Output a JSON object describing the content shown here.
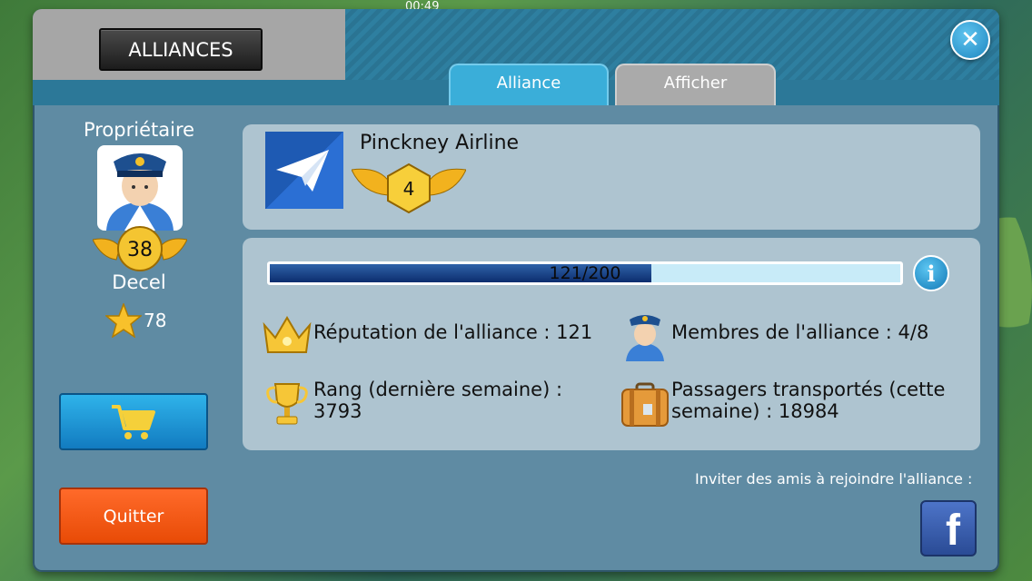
{
  "status_bar": {
    "time": "00:49"
  },
  "dialog": {
    "title": "ALLIANCES",
    "tabs": [
      {
        "label": "Alliance",
        "active": true
      },
      {
        "label": "Afficher",
        "active": false
      }
    ]
  },
  "owner": {
    "label": "Propriétaire",
    "level": "38",
    "name": "Decel",
    "stars": "78"
  },
  "buttons": {
    "quit_label": "Quitter"
  },
  "alliance": {
    "name": "Pinckney Airline",
    "level": "4",
    "reputation_progress": {
      "text": "121/200",
      "current": 121,
      "max": 200
    },
    "stats": {
      "reputation": "Réputation de l'alliance : 121",
      "members": "Membres de l'alliance : 4/8",
      "rank_line1": "Rang (dernière semaine) :",
      "rank_line2": "3793",
      "passengers_line1": "Passagers transportés (cette",
      "passengers_line2": "semaine) : 18984"
    }
  },
  "invite": {
    "text": "Inviter des amis à rejoindre l'alliance :",
    "facebook_glyph": "f"
  },
  "colors": {
    "tab_active": "#3aaed9",
    "progress_fill": "#0c2d6e",
    "quit_button": "#e84b06",
    "cart_button": "#127bc0",
    "facebook": "#3b5998"
  }
}
